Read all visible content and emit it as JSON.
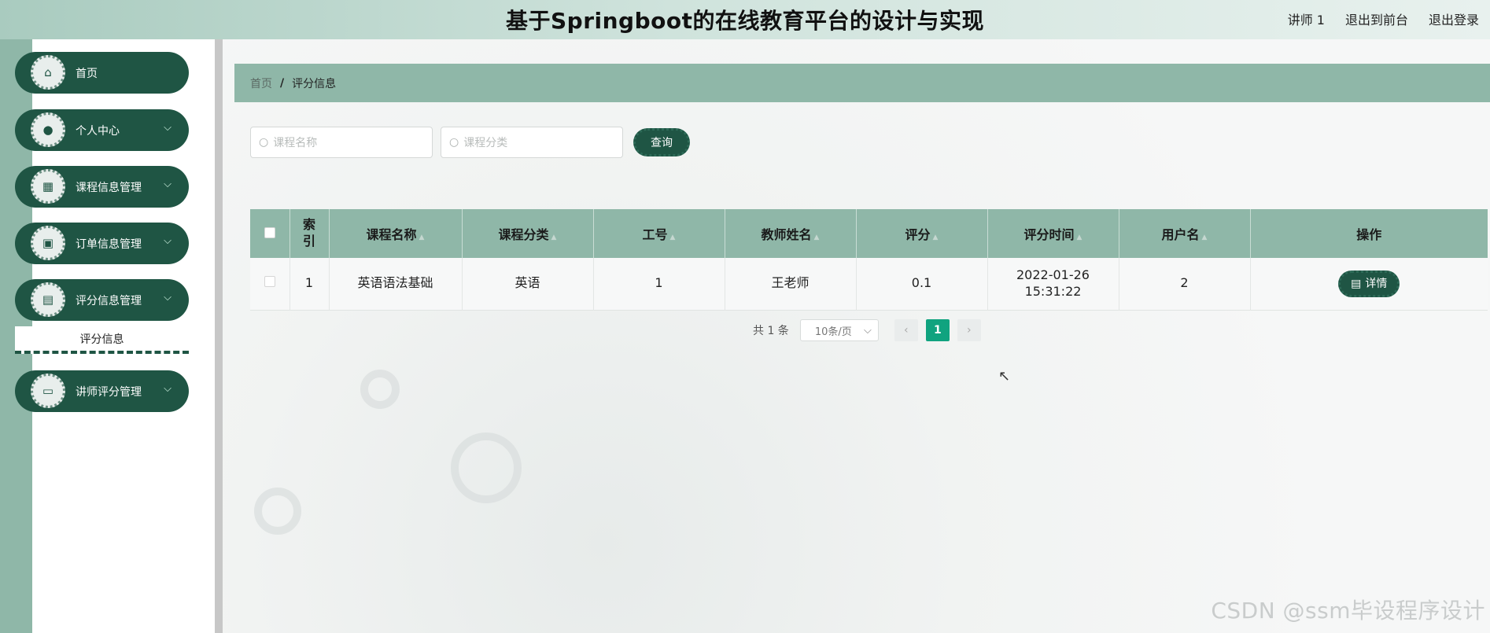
{
  "header": {
    "title": "基于Springboot的在线教育平台的设计与实现",
    "nav": [
      "讲师 1",
      "退出到前台",
      "退出登录"
    ]
  },
  "sidebar": {
    "items": [
      {
        "label": "首页",
        "icon": "home-icon",
        "has_chevron": false
      },
      {
        "label": "个人中心",
        "icon": "user-icon",
        "has_chevron": true
      },
      {
        "label": "课程信息管理",
        "icon": "grid-icon",
        "has_chevron": true
      },
      {
        "label": "订单信息管理",
        "icon": "briefcase-icon",
        "has_chevron": true
      },
      {
        "label": "评分信息管理",
        "icon": "document-icon",
        "has_chevron": true
      },
      {
        "label": "讲师评分管理",
        "icon": "chat-icon",
        "has_chevron": true
      }
    ],
    "submenu": "评分信息"
  },
  "breadcrumb": {
    "home": "首页",
    "separator": "/",
    "current": "评分信息"
  },
  "search": {
    "course_name_placeholder": "课程名称",
    "course_category_placeholder": "课程分类",
    "query_label": "查询"
  },
  "table": {
    "headers": [
      "索引",
      "课程名称",
      "课程分类",
      "工号",
      "教师姓名",
      "评分",
      "评分时间",
      "用户名",
      "操作"
    ],
    "rows": [
      {
        "index": "1",
        "course_name": "英语语法基础",
        "course_category": "英语",
        "job_no": "1",
        "teacher_name": "王老师",
        "score": "0.1",
        "score_time": "2022-01-26 15:31:22",
        "username": "2",
        "action": "详情"
      }
    ]
  },
  "pagination": {
    "total": "共 1 条",
    "page_size": "10条/页",
    "current_page": "1"
  },
  "watermark": "CSDN @ssm毕设程序设计",
  "colors": {
    "primary": "#1f5544",
    "accent": "#8fb7a8",
    "page_active": "#10a37f"
  }
}
